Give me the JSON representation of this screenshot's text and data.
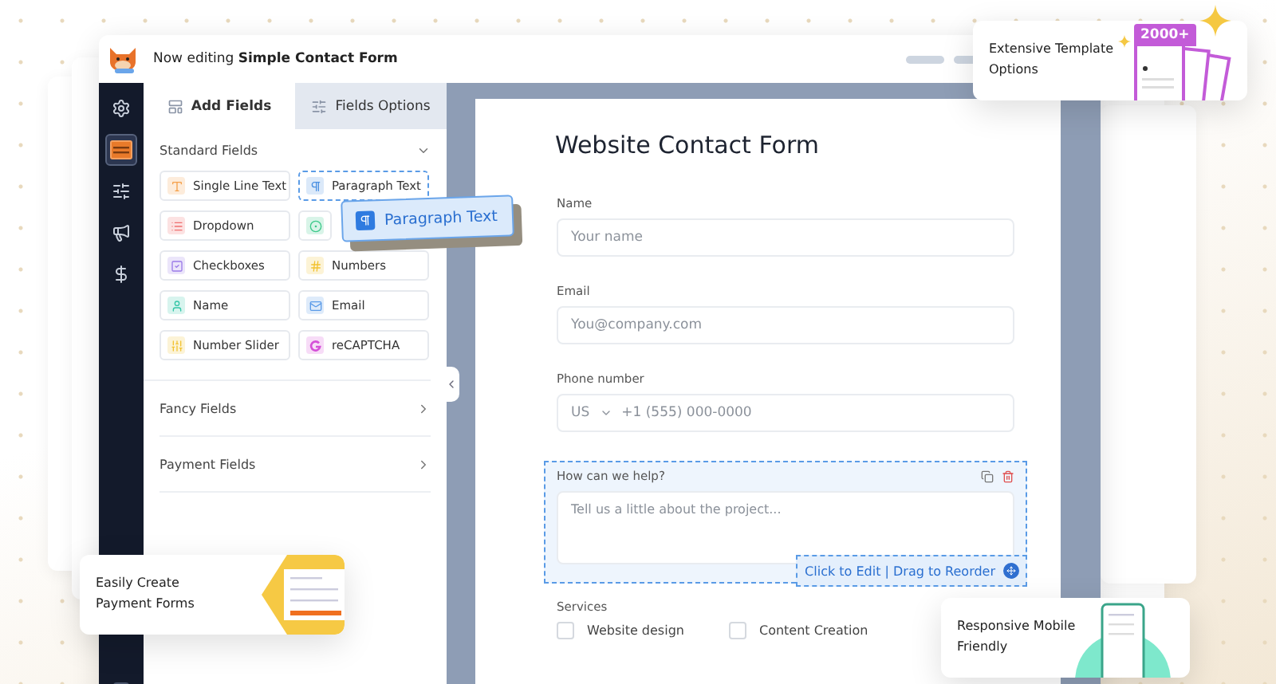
{
  "header": {
    "title": "Now editing **Simple Contact Form**"
  },
  "sidebar": {
    "items": [
      {
        "selected": false
      },
      {
        "selected": true
      },
      {
        "selected": false
      },
      {
        "selected": false
      },
      {
        "selected": false
      }
    ]
  },
  "panel": {
    "tabs": [
      {
        "label": "Add Fields",
        "selected": true
      },
      {
        "label": "Fields Options",
        "selected": false
      }
    ],
    "sections": [
      {
        "title": "Standard Fields",
        "expanded": true,
        "fields": [
          {
            "label": "Single Line Text",
            "color": "#f5a04a",
            "dragging": false
          },
          {
            "label": "Paragraph Text",
            "color": "#4a90e2",
            "dragging": true
          },
          {
            "label": "Dropdown",
            "color": "#ef6f6f",
            "dragging": false
          },
          {
            "color": "#3cc98a",
            "dragging": false
          },
          {
            "label": "Checkboxes",
            "color": "#9b7be8",
            "dragging": false
          },
          {
            "label": "Numbers",
            "color": "#f2c230",
            "dragging": false
          },
          {
            "label": "Name",
            "color": "#36c6a8",
            "dragging": false
          },
          {
            "label": "Email",
            "color": "#5b9be8",
            "dragging": false
          },
          {
            "label": "Number Slider",
            "color": "#f2c230",
            "dragging": false
          },
          {
            "label": "reCAPTCHA",
            "color": "#d54fd8",
            "dragging": false
          }
        ]
      },
      {
        "title": "Fancy Fields",
        "expanded": false
      },
      {
        "title": "Payment Fields",
        "expanded": false
      }
    ]
  },
  "drag_preview": {
    "label": "Paragraph Text"
  },
  "form": {
    "title": "Website Contact Form",
    "fields": [
      {
        "kind": "text",
        "label": "Name",
        "placeholder": "Your name",
        "selected": false
      },
      {
        "kind": "text",
        "label": "Email",
        "placeholder": "You@company.com",
        "selected": false
      },
      {
        "kind": "phone",
        "label": "Phone number",
        "country": "US",
        "placeholder": "+1 (555) 000-0000",
        "selected": false
      },
      {
        "kind": "textarea",
        "label": "How can we help?",
        "placeholder": "Tell us a little about the project...",
        "selected": true,
        "hint": "Click to Edit | Drag to Reorder"
      },
      {
        "kind": "checkboxes",
        "label": "Services",
        "selected": false,
        "options": [
          {
            "label": "Website design",
            "checked": false
          },
          {
            "label": "Content Creation",
            "checked": false
          }
        ]
      }
    ]
  },
  "callouts": [
    {
      "kind": "templates",
      "text": "Extensive Template Options",
      "badge": "2000+"
    },
    {
      "kind": "payment",
      "text": "Easily Create Payment Forms"
    },
    {
      "kind": "mobile",
      "text": "Responsive Mobile Friendly"
    }
  ]
}
